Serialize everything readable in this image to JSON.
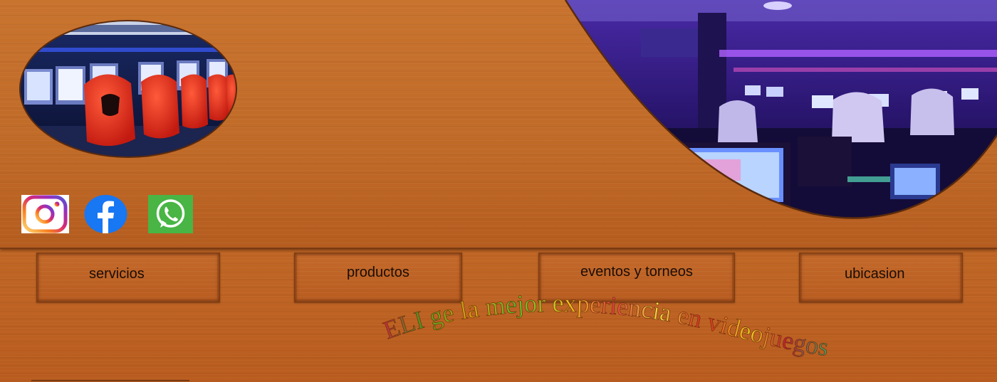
{
  "nav": {
    "items": [
      {
        "label": "servicios"
      },
      {
        "label": "productos"
      },
      {
        "label": "eventos y torneos"
      },
      {
        "label": "ubicasion"
      }
    ]
  },
  "social": {
    "items": [
      {
        "icon": "instagram-icon",
        "color": "#d62976"
      },
      {
        "icon": "facebook-icon",
        "color": "#1877f2"
      },
      {
        "icon": "whatsapp-icon",
        "color": "#48b544"
      }
    ]
  },
  "tagline": {
    "text": "ELI ge la mejor experiencia en videojuegos"
  },
  "colors": {
    "wood": "#c26a27",
    "wood_dark": "#7a3a10",
    "room_purple": "#3a1c80"
  }
}
